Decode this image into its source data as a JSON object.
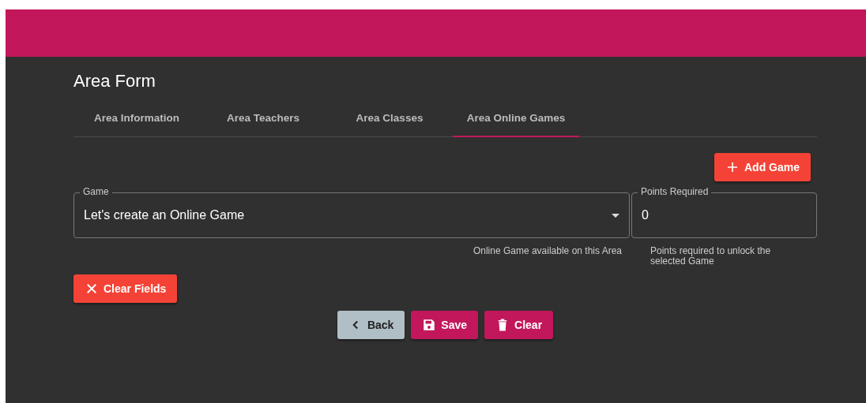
{
  "page": {
    "title": "Area Form"
  },
  "tabs": [
    {
      "label": "Area Information",
      "selected": false
    },
    {
      "label": "Area Teachers",
      "selected": false
    },
    {
      "label": "Area Classes",
      "selected": false
    },
    {
      "label": "Area Online Games",
      "selected": true
    }
  ],
  "add_button": {
    "label": "Add Game"
  },
  "fields": [
    {
      "kind": "select",
      "label": "Game",
      "value": "Let's create an Online Game",
      "hint": "Online Game available on this Area"
    },
    {
      "kind": "number",
      "label": "Points Required",
      "value": "0",
      "hint": "Points required to unlock the selected Game"
    }
  ],
  "clear_fields_button": {
    "label": "Clear Fields"
  },
  "actions": [
    {
      "kind": "back",
      "label": "Back"
    },
    {
      "kind": "save",
      "label": "Save"
    },
    {
      "kind": "clear",
      "label": "Clear"
    }
  ]
}
